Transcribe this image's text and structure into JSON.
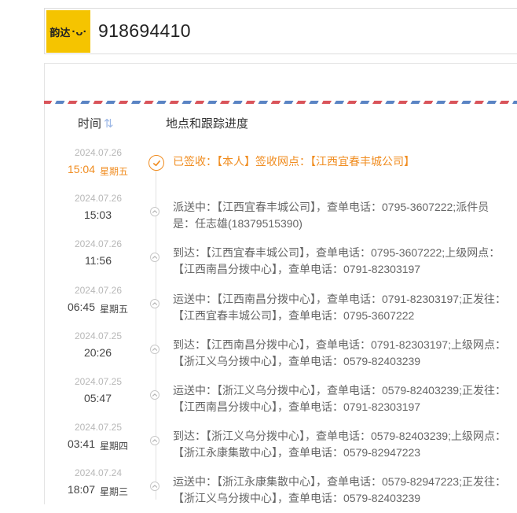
{
  "header": {
    "logo_text": "韵达",
    "tracking_number": "918694410"
  },
  "columns": {
    "time_label": "时间",
    "time_sort_glyph": "⇅",
    "location_label": "地点和跟踪进度"
  },
  "colors": {
    "accent_orange": "#f08c1f",
    "airmail_red": "#d9545a",
    "airmail_blue": "#5a84c4",
    "logo_yellow": "#f5c400"
  },
  "events": [
    {
      "date": "2024.07.26",
      "time": "15:04",
      "weekday": "星期五",
      "text": "已签收：【本人】签收网点：【江西宜春丰城公司】",
      "status": "signed",
      "icon": "check-circle-icon"
    },
    {
      "date": "2024.07.26",
      "time": "15:03",
      "weekday": "",
      "text": "派送中：【江西宜春丰城公司】，查单电话：0795-3607222;派件员是：任志雄(18379515390)",
      "status": "normal",
      "icon": "chevron-up-icon"
    },
    {
      "date": "2024.07.26",
      "time": "11:56",
      "weekday": "",
      "text": "到达：【江西宜春丰城公司】，查单电话：0795-3607222;上级网点：【江西南昌分拨中心】，查单电话：0791-82303197",
      "status": "normal",
      "icon": "chevron-up-icon"
    },
    {
      "date": "2024.07.26",
      "time": "06:45",
      "weekday": "星期五",
      "text": "运送中：【江西南昌分拨中心】，查单电话：0791-82303197;正发往：【江西宜春丰城公司】，查单电话：0795-3607222",
      "status": "normal",
      "icon": "chevron-up-icon"
    },
    {
      "date": "2024.07.25",
      "time": "20:26",
      "weekday": "",
      "text": "到达：【江西南昌分拨中心】，查单电话：0791-82303197;上级网点：【浙江义乌分拨中心】，查单电话：0579-82403239",
      "status": "normal",
      "icon": "chevron-up-icon"
    },
    {
      "date": "2024.07.25",
      "time": "05:47",
      "weekday": "",
      "text": "运送中：【浙江义乌分拨中心】，查单电话：0579-82403239;正发往：【江西南昌分拨中心】，查单电话：0791-82303197",
      "status": "normal",
      "icon": "chevron-up-icon"
    },
    {
      "date": "2024.07.25",
      "time": "03:41",
      "weekday": "星期四",
      "text": "到达：【浙江义乌分拨中心】，查单电话：0579-82403239;上级网点：【浙江永康集散中心】，查单电话：0579-82947223",
      "status": "normal",
      "icon": "chevron-up-icon"
    },
    {
      "date": "2024.07.24",
      "time": "18:07",
      "weekday": "星期三",
      "text": "运送中：【浙江永康集散中心】，查单电话：0579-82947223;正发往：【浙江义乌分拨中心】，查单电话：0579-82403239",
      "status": "normal",
      "icon": "chevron-up-icon"
    }
  ]
}
